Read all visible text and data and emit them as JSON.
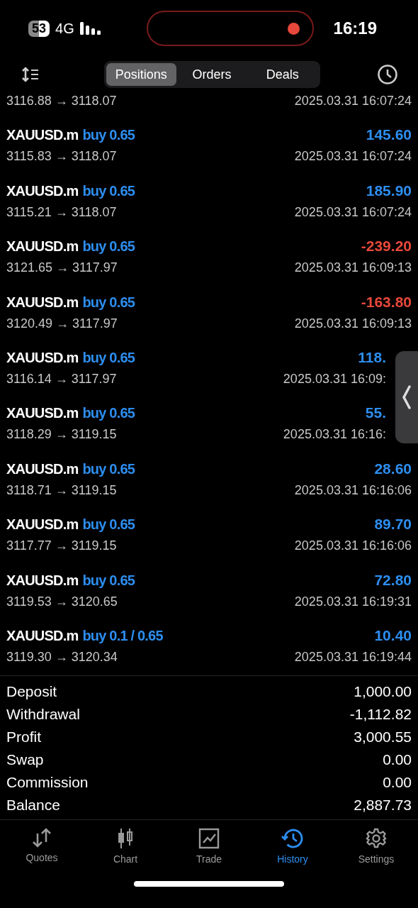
{
  "status_bar": {
    "battery": "53",
    "network": "4G",
    "time": "16:19"
  },
  "tabs": [
    {
      "label": "Positions",
      "selected": true
    },
    {
      "label": "Orders",
      "selected": false
    },
    {
      "label": "Deals",
      "selected": false
    }
  ],
  "partial_deal": {
    "prices": "3116.88 → 3118.07",
    "time": "2025.03.31 16:07:24"
  },
  "deals": [
    {
      "symbol": "XAUUSD.m",
      "side": "buy 0.65",
      "profit": "145.60",
      "negative": false,
      "prices": "3115.83 → 3118.07",
      "time": "2025.03.31 16:07:24"
    },
    {
      "symbol": "XAUUSD.m",
      "side": "buy 0.65",
      "profit": "185.90",
      "negative": false,
      "prices": "3115.21 → 3118.07",
      "time": "2025.03.31 16:07:24"
    },
    {
      "symbol": "XAUUSD.m",
      "side": "buy 0.65",
      "profit": "-239.20",
      "negative": true,
      "prices": "3121.65 → 3117.97",
      "time": "2025.03.31 16:09:13"
    },
    {
      "symbol": "XAUUSD.m",
      "side": "buy 0.65",
      "profit": "-163.80",
      "negative": true,
      "prices": "3120.49 → 3117.97",
      "time": "2025.03.31 16:09:13"
    },
    {
      "symbol": "XAUUSD.m",
      "side": "buy 0.65",
      "profit": "118.",
      "negative": false,
      "behind_panel": true,
      "prices": "3116.14 → 3117.97",
      "time": "2025.03.31 16:09:"
    },
    {
      "symbol": "XAUUSD.m",
      "side": "buy 0.65",
      "profit": "55.",
      "negative": false,
      "behind_panel": true,
      "prices": "3118.29 → 3119.15",
      "time": "2025.03.31 16:16:"
    },
    {
      "symbol": "XAUUSD.m",
      "side": "buy 0.65",
      "profit": "28.60",
      "negative": false,
      "prices": "3118.71 → 3119.15",
      "time": "2025.03.31 16:16:06"
    },
    {
      "symbol": "XAUUSD.m",
      "side": "buy 0.65",
      "profit": "89.70",
      "negative": false,
      "prices": "3117.77 → 3119.15",
      "time": "2025.03.31 16:16:06"
    },
    {
      "symbol": "XAUUSD.m",
      "side": "buy 0.65",
      "profit": "72.80",
      "negative": false,
      "prices": "3119.53 → 3120.65",
      "time": "2025.03.31 16:19:31"
    },
    {
      "symbol": "XAUUSD.m",
      "side": "buy 0.1 / 0.65",
      "profit": "10.40",
      "negative": false,
      "prices": "3119.30 → 3120.34",
      "time": "2025.03.31 16:19:44"
    }
  ],
  "summary": [
    {
      "label": "Deposit",
      "value": "1,000.00"
    },
    {
      "label": "Withdrawal",
      "value": "-1,112.82"
    },
    {
      "label": "Profit",
      "value": "3,000.55"
    },
    {
      "label": "Swap",
      "value": "0.00"
    },
    {
      "label": "Commission",
      "value": "0.00"
    },
    {
      "label": "Balance",
      "value": "2,887.73"
    }
  ],
  "nav": [
    {
      "kind": "quotes",
      "label": "Quotes",
      "selected": false
    },
    {
      "kind": "chart",
      "label": "Chart",
      "selected": false
    },
    {
      "kind": "trade",
      "label": "Trade",
      "selected": false
    },
    {
      "kind": "history",
      "label": "History",
      "selected": true
    },
    {
      "kind": "settings",
      "label": "Settings",
      "selected": false
    }
  ]
}
